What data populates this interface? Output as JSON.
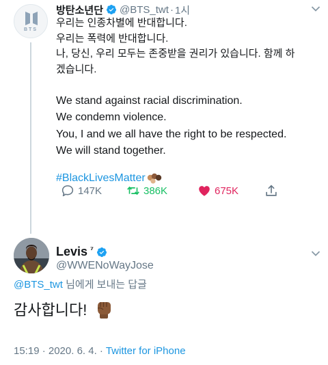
{
  "original_tweet": {
    "author_name": "방탄소년단",
    "handle": "@BTS_twt",
    "separator": "·",
    "time": "1시",
    "avatar_word": "BTS",
    "body_korean": [
      "우리는 인종차별에 반대합니다.",
      "우리는 폭력에 반대합니다.",
      "나, 당신, 우리 모두는 존중받을 권리가 있습니다. 함께 하",
      "겠습니다."
    ],
    "body_english": [
      "We stand against racial discrimination.",
      "We condemn violence.",
      "You, I and we all have the right to be respected.",
      "We will stand together."
    ],
    "hashtag": "#BlackLivesMatter",
    "actions": {
      "replies": "147K",
      "retweets": "386K",
      "likes": "675K"
    }
  },
  "reply_tweet": {
    "author_name": "Levis",
    "name_suffix": "⁷",
    "handle": "@WWENoWayJose",
    "replying_to_mention": "@BTS_twt",
    "replying_to_suffix": " 님에게 보내는 답글",
    "text": "감사합니다!",
    "timestamp": "15:19 · 2020. 6. 4. · ",
    "source": "Twitter for iPhone"
  },
  "colors": {
    "link_blue": "#1b95e0",
    "retweet_green": "#17bf63",
    "like_red": "#e0245e",
    "muted_gray": "#657786",
    "verified_blue": "#1da1f2"
  },
  "icons": {
    "reply": "comment-bubble-icon",
    "retweet": "retweet-arrows-icon",
    "like": "heart-filled-icon",
    "share": "share-upload-icon",
    "verified": "verified-badge-icon",
    "more": "chevron-down-icon"
  }
}
